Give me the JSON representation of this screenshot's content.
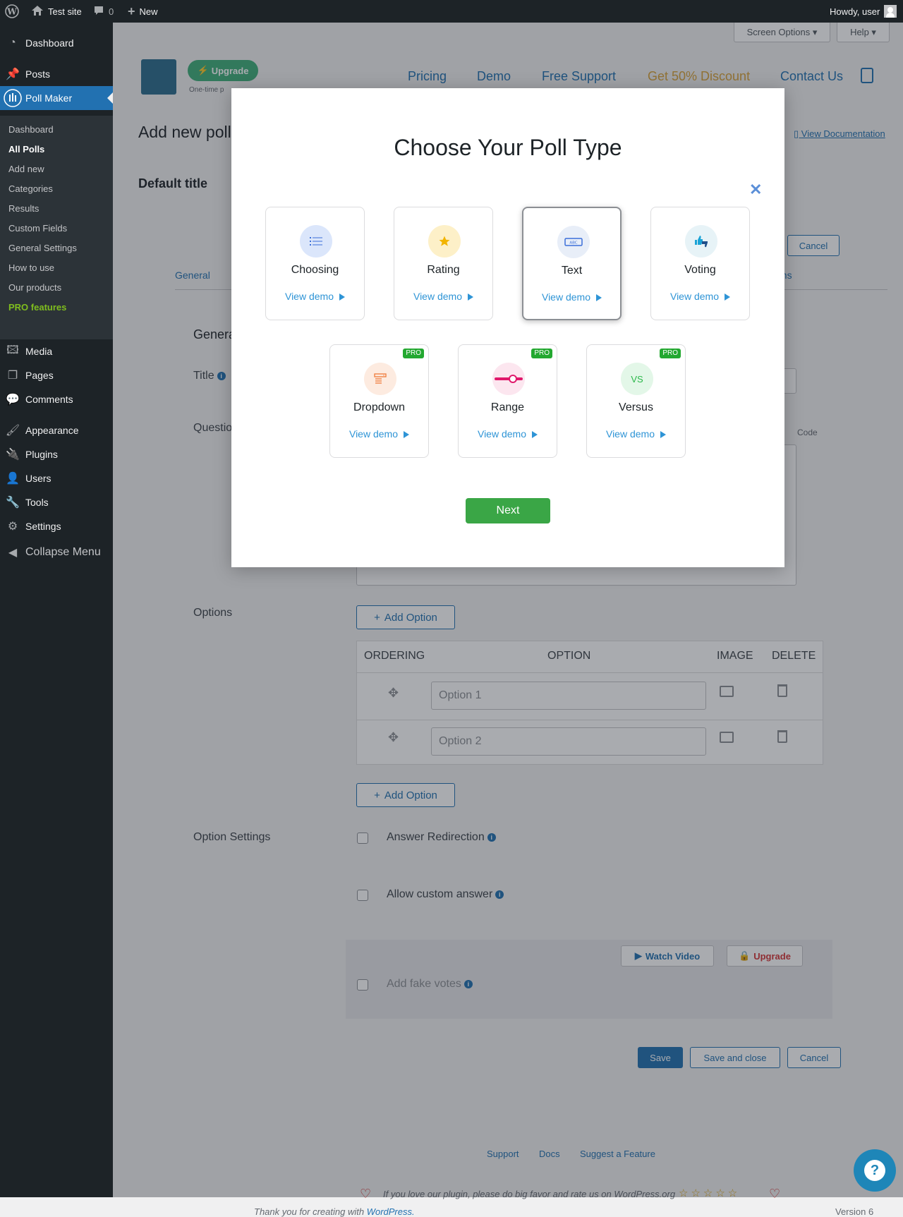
{
  "adminbar": {
    "site_name": "Test site",
    "comments_count": "0",
    "new_label": "New",
    "howdy": "Howdy, user"
  },
  "sidebar": {
    "items": [
      {
        "label": "Dashboard",
        "icon": "dashboard-icon"
      },
      {
        "label": "Posts",
        "icon": "pin-icon"
      },
      {
        "label": "Poll Maker",
        "icon": "poll-maker-icon"
      },
      {
        "label": "Media",
        "icon": "media-icon"
      },
      {
        "label": "Pages",
        "icon": "pages-icon"
      },
      {
        "label": "Comments",
        "icon": "comments-icon"
      },
      {
        "label": "Appearance",
        "icon": "brush-icon"
      },
      {
        "label": "Plugins",
        "icon": "plugins-icon"
      },
      {
        "label": "Users",
        "icon": "users-icon"
      },
      {
        "label": "Tools",
        "icon": "wrench-icon"
      },
      {
        "label": "Settings",
        "icon": "settings-icon"
      },
      {
        "label": "Collapse Menu",
        "icon": "collapse-icon"
      }
    ],
    "submenu": [
      "Dashboard",
      "All Polls",
      "Add new",
      "Categories",
      "Results",
      "Custom Fields",
      "General Settings",
      "How to use",
      "Our products",
      "PRO features"
    ]
  },
  "background": {
    "screen_options": "Screen Options ▾",
    "help": "Help ▾",
    "upgrade": "Upgrade",
    "upgrade_sub": "One-time p",
    "nav": [
      "Pricing",
      "Demo",
      "Free Support",
      "Get 50% Discount",
      "Contact Us"
    ],
    "page_title": "Add new poll",
    "view_docs": "View Documentation",
    "default_title": "Default title",
    "cancel_top": "Cancel",
    "tab_general": "General",
    "tab_right": "ons",
    "section_general": "Genera",
    "title_label": "Title",
    "question_label": "Questio",
    "code_label": "Code",
    "options_label": "Options",
    "add_option": "Add Option",
    "table_headers": [
      "ORDERING",
      "OPTION",
      "IMAGE",
      "DELETE"
    ],
    "options": [
      "Option 1",
      "Option 2"
    ],
    "option_settings": "Option Settings",
    "answer_redirection": "Answer Redirection",
    "allow_custom_answer": "Allow custom answer",
    "watch_video": "Watch Video",
    "upgrade_small": "Upgrade",
    "add_fake_votes": "Add fake votes",
    "save": "Save",
    "save_close": "Save and close",
    "cancel_bottom": "Cancel",
    "footer_links": [
      "Support",
      "Docs",
      "Suggest a Feature"
    ],
    "footer_love": "If you love our plugin, please do big favor and rate us on WordPress.org",
    "footer_thanks": "Thank you for creating with",
    "footer_wp": "WordPress.",
    "footer_version": "Version 6"
  },
  "modal": {
    "title": "Choose Your Poll Type",
    "next_label": "Next",
    "demo_label": "View demo",
    "pro_label": "PRO",
    "types": [
      {
        "label": "Choosing",
        "icon": "list-icon",
        "color": "#dbe6fb",
        "pro": false,
        "selected": false
      },
      {
        "label": "Rating",
        "icon": "star-icon",
        "color": "#fdf0c8",
        "pro": false,
        "selected": false
      },
      {
        "label": "Text",
        "icon": "text-input-icon",
        "color": "#e8eef8",
        "pro": false,
        "selected": true
      },
      {
        "label": "Voting",
        "icon": "thumbs-icon",
        "color": "#e7f3f7",
        "pro": false,
        "selected": false
      },
      {
        "label": "Dropdown",
        "icon": "dropdown-icon",
        "color": "#fdebe0",
        "pro": true,
        "selected": false
      },
      {
        "label": "Range",
        "icon": "slider-icon",
        "color": "#fce6ef",
        "pro": true,
        "selected": false
      },
      {
        "label": "Versus",
        "icon": "versus-icon",
        "color": "#e3f7e8",
        "pro": true,
        "selected": false
      }
    ]
  },
  "colors": {
    "wp_blue": "#2271b1",
    "next_green": "#3aa646",
    "pro_green": "#23a830",
    "demo_blue": "#2e94d6"
  }
}
